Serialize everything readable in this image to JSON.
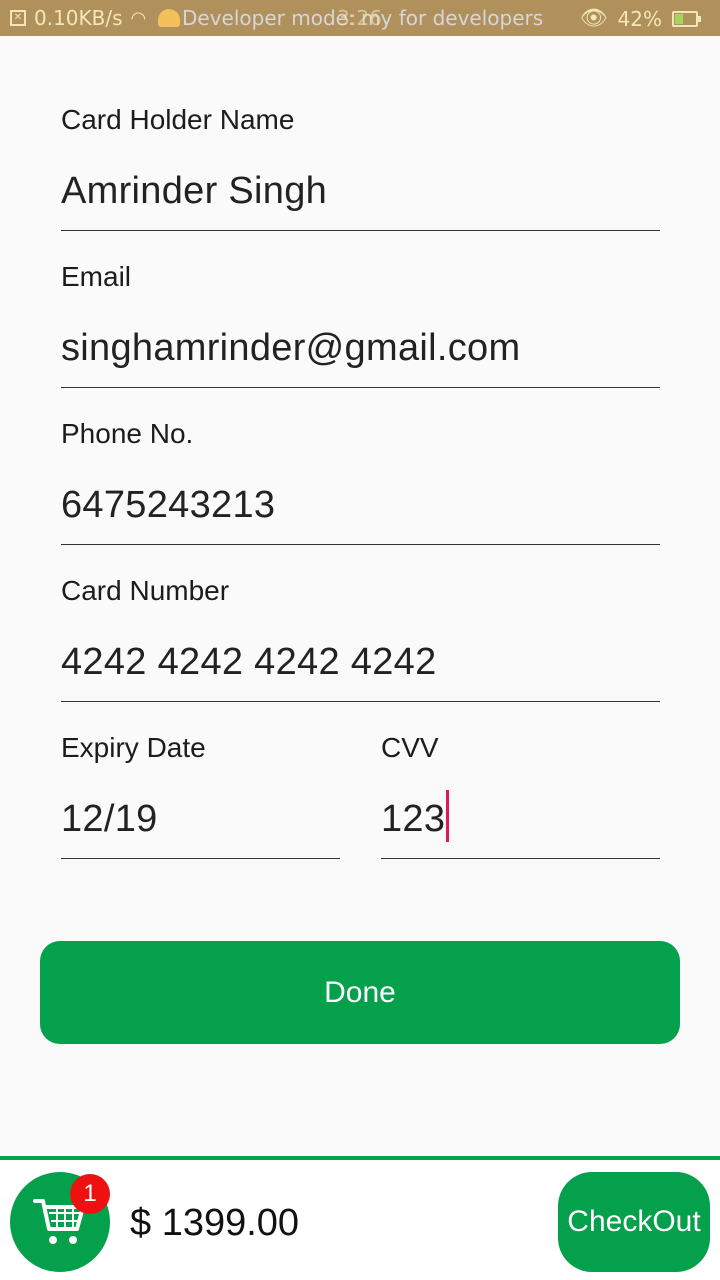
{
  "status_bar": {
    "speed": "0.10KB/s",
    "overlay_text": "Developer mode: my for developers",
    "time": "3:26",
    "battery": "42%",
    "battery_level": 0.42,
    "colors": {
      "bar": "#b0915b",
      "battery_fill": "#a5d65c"
    }
  },
  "form": {
    "card_holder": {
      "label": "Card Holder Name",
      "value": "Amrinder Singh"
    },
    "email": {
      "label": "Email",
      "value": "singhamrinder@gmail.com"
    },
    "phone": {
      "label": "Phone No.",
      "value": "6475243213"
    },
    "card_number": {
      "label": "Card Number",
      "value": "4242 4242 4242 4242"
    },
    "expiry": {
      "label": "Expiry Date",
      "value": "12/19"
    },
    "cvv": {
      "label": "CVV",
      "value": "123"
    }
  },
  "done_button": {
    "label": "Done"
  },
  "bottom_bar": {
    "cart_icon": "shopping-cart-icon",
    "cart_count": "1",
    "total": "$ 1399.00",
    "checkout_label": "CheckOut"
  },
  "colors": {
    "accent": "#04a04c",
    "badge": "#ee1111",
    "caret": "#d81b60"
  }
}
